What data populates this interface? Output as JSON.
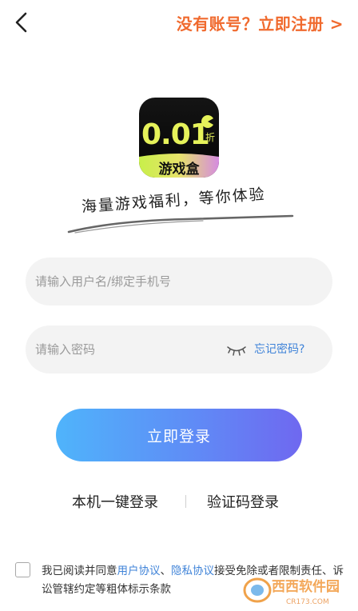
{
  "header": {
    "back_icon": "chevron-left-icon",
    "register_prompt": "没有账号？立即注册 >"
  },
  "colors": {
    "accent_orange": "#f06a2e",
    "link_blue": "#3f83d8",
    "button_gradient_start": "#4fb4fb",
    "button_gradient_end": "#6f68f0",
    "field_bg": "#f3f3f3"
  },
  "logo": {
    "number": "0.01",
    "discount_char": "折",
    "name": "游戏盒"
  },
  "slogan": "海量游戏福利，等你体验",
  "form": {
    "username_placeholder": "请输入用户名/绑定手机号",
    "password_placeholder": "请输入密码",
    "eye_icon": "eye-closed-icon",
    "forgot_password": "忘记密码?"
  },
  "login_button": "立即登录",
  "alt_login": {
    "one_click": "本机一键登录",
    "sms_code": "验证码登录"
  },
  "agreement": {
    "prefix": "我已阅读并同意",
    "user_agreement": "用户协议",
    "separator": "、",
    "privacy_agreement": "隐私协议",
    "suffix": "接受免除或者限制责任、诉讼管辖约定等粗体标示条款"
  },
  "watermark": {
    "text": "西西软件园",
    "domain": "CR173.COM"
  }
}
